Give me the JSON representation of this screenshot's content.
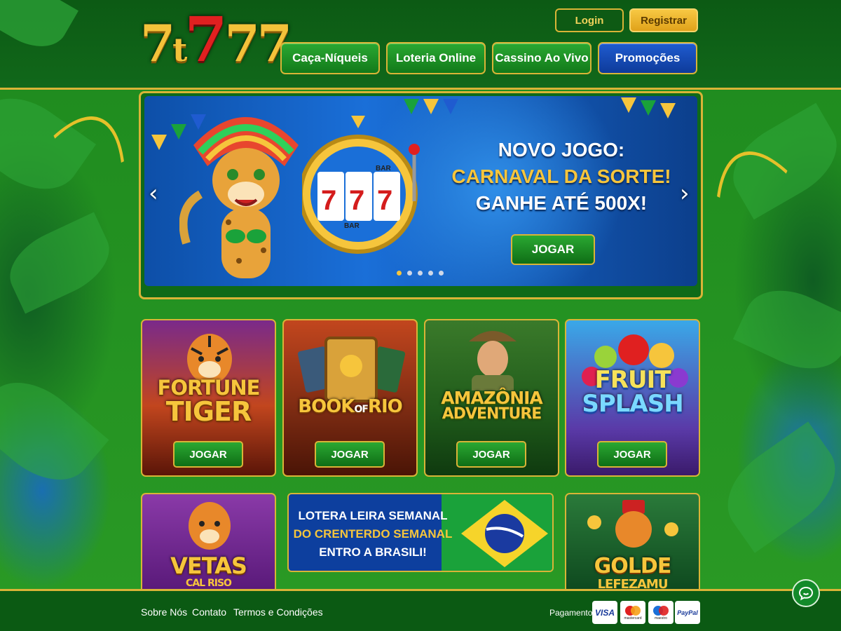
{
  "brand": {
    "logo_text": "7t777"
  },
  "auth": {
    "login": "Login",
    "register": "Registrar"
  },
  "nav": {
    "items": [
      {
        "label": "Caça-Níqueis"
      },
      {
        "label": "Loteria Online"
      },
      {
        "label": "Cassino Ao Vivo"
      },
      {
        "label": "Promoções"
      }
    ]
  },
  "banner": {
    "line1": "NOVO JOGO:",
    "line2": "CARNAVAL DA SORTE!",
    "line3": "GANHE ATÉ 500X!",
    "play": "JOGAR",
    "slot_symbols": [
      "7",
      "7",
      "7"
    ],
    "slot_labels": [
      "BAR",
      "BAR"
    ],
    "slide_count": 5,
    "active_slide": 1
  },
  "games": [
    {
      "title_l1": "FORTUNE",
      "title_l2": "TIGER",
      "play": "JOGAR"
    },
    {
      "title_l1": "BOOK",
      "title_mid": "OF",
      "title_l2": "RIO",
      "play": "JOGAR"
    },
    {
      "title_l1": "AMAZÔNIA",
      "title_l2": "ADVENTURE",
      "play": "JOGAR"
    },
    {
      "title_l1": "FRUIT",
      "title_l2": "SPLASH",
      "play": "JOGAR"
    }
  ],
  "bottom_row": {
    "vegas_title": "VETAS",
    "vegas_sub": "CAL RISO",
    "lottery": {
      "line1": "LOTERA LEIRA SEMANAL",
      "line2": "DO CRENTERDO SEMANAL",
      "line3": "ENTRO A BRASILI!"
    },
    "golden_title": "GOLDE",
    "golden_sub": "LEFEZAMU"
  },
  "footer": {
    "links": [
      "Sobre Nós",
      "Contato",
      "Termos e Condições"
    ],
    "payment_label": "Pagamento:",
    "payments": [
      {
        "name": "VISA"
      },
      {
        "name": "mastercard",
        "caption": "mastercard"
      },
      {
        "name": "maestro",
        "caption": "maestro"
      },
      {
        "name": "PayPal"
      }
    ]
  },
  "colors": {
    "gold": "#d9b437",
    "green": "#1f7a1f",
    "blue_promo": "#1f5bd0",
    "accent_yellow": "#f6c53c"
  }
}
